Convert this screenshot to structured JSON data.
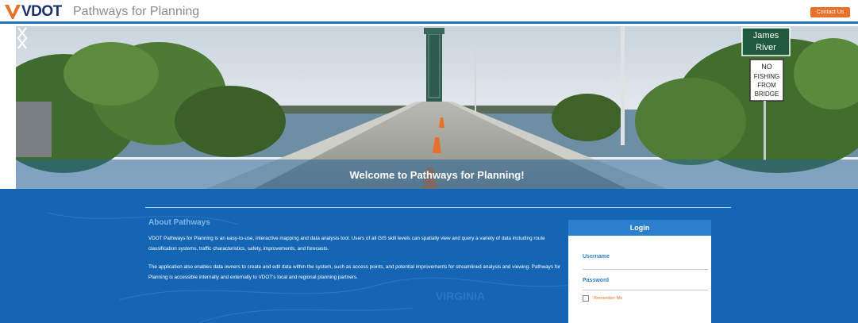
{
  "header": {
    "logo_text": "VDOT",
    "app_title": "Pathways for Planning",
    "contact_label": "Contact Us"
  },
  "hero": {
    "title": "Welcome to Pathways for Planning!",
    "sign_top": "James River",
    "sign_line1": "NO",
    "sign_line2": "FISHING",
    "sign_line3": "FROM",
    "sign_line4": "BRIDGE"
  },
  "about": {
    "title": "About Pathways",
    "p1": "VDOT Pathways for Planning is an easy-to-use, interactive mapping and data analysis tool. Users of all GIS skill levels can spatially view and query a variety of data including route classification systems, traffic characteristics, safety, improvements, and forecasts.",
    "p2": "The application also enables data owners to create and edit data within the system, such as access points, and potential improvements for streamlined analysis and viewing. Pathways for Planning is accessible internally and externally to VDOT's local and regional planning partners."
  },
  "login": {
    "title": "Login",
    "username_label": "Username",
    "password_label": "Password",
    "remember_label": "Remember Me"
  },
  "map_label": "VIRGINIA",
  "colors": {
    "brand_blue": "#1466b4",
    "accent_orange": "#e8702a",
    "header_rule": "#2872b8"
  }
}
